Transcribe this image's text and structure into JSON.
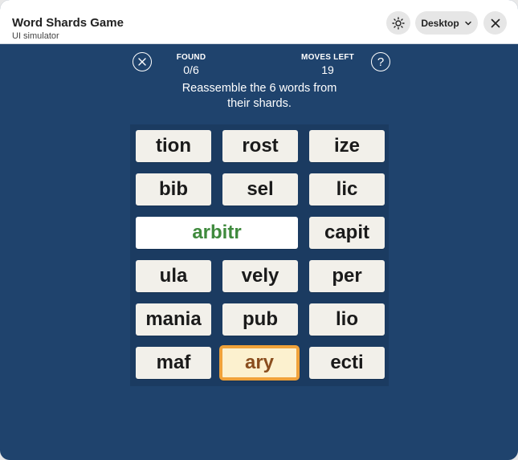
{
  "app": {
    "title": "Word Shards Game",
    "subtitle": "UI simulator"
  },
  "toolbar": {
    "theme_icon": "sun-icon",
    "view_mode": "Desktop",
    "view_icon": "chevron-down-icon",
    "close_icon": "close-icon"
  },
  "game": {
    "found_label": "FOUND",
    "found_value": "0/6",
    "moves_label": "MOVES LEFT",
    "moves_value": "19",
    "help_symbol": "?",
    "instructions": "Reassemble the 6 words from their shards."
  },
  "tiles": [
    {
      "text": "tion",
      "state": "normal"
    },
    {
      "text": "rost",
      "state": "normal"
    },
    {
      "text": "ize",
      "state": "normal"
    },
    {
      "text": "bib",
      "state": "normal"
    },
    {
      "text": "sel",
      "state": "normal"
    },
    {
      "text": "lic",
      "state": "normal"
    },
    {
      "text": "arbitr",
      "state": "merged",
      "color": "#3f8a3d"
    },
    {
      "text": "capit",
      "state": "normal"
    },
    {
      "text": "ula",
      "state": "normal"
    },
    {
      "text": "vely",
      "state": "normal"
    },
    {
      "text": "per",
      "state": "normal"
    },
    {
      "text": "mania",
      "state": "normal"
    },
    {
      "text": "pub",
      "state": "normal"
    },
    {
      "text": "lio",
      "state": "normal"
    },
    {
      "text": "maf",
      "state": "normal"
    },
    {
      "text": "ary",
      "state": "selected",
      "color": "#f0a23a"
    },
    {
      "text": "ecti",
      "state": "normal"
    }
  ],
  "colors": {
    "background": "#1f436d",
    "selected_border": "#f0a23a",
    "merged_text": "#3f8a3d"
  }
}
